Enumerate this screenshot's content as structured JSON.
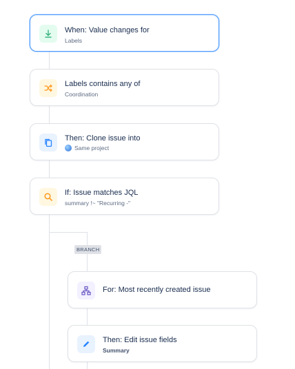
{
  "flow": {
    "trigger": {
      "title": "When: Value changes for",
      "subtitle": "Labels",
      "icon": "download-arrow-icon",
      "color": "#36b37e"
    },
    "condition_labels": {
      "title": "Labels contains any of",
      "subtitle": "Coordination",
      "icon": "shuffle-icon",
      "color": "#ff991f"
    },
    "action_clone": {
      "title": "Then: Clone issue into",
      "subtitle": "Same project",
      "icon": "copy-icon",
      "color": "#2684ff"
    },
    "condition_jql": {
      "title": "If: Issue matches JQL",
      "subtitle": "summary !~ \"Recurring -\"",
      "icon": "search-icon",
      "color": "#ff991f"
    },
    "branch": {
      "label": "BRANCH"
    },
    "branch_for": {
      "title": "For: Most recently created issue",
      "icon": "hierarchy-icon",
      "color": "#6554c0"
    },
    "action_edit": {
      "title": "Then: Edit issue fields",
      "subtitle": "Summary",
      "icon": "pencil-icon",
      "color": "#2684ff"
    }
  }
}
